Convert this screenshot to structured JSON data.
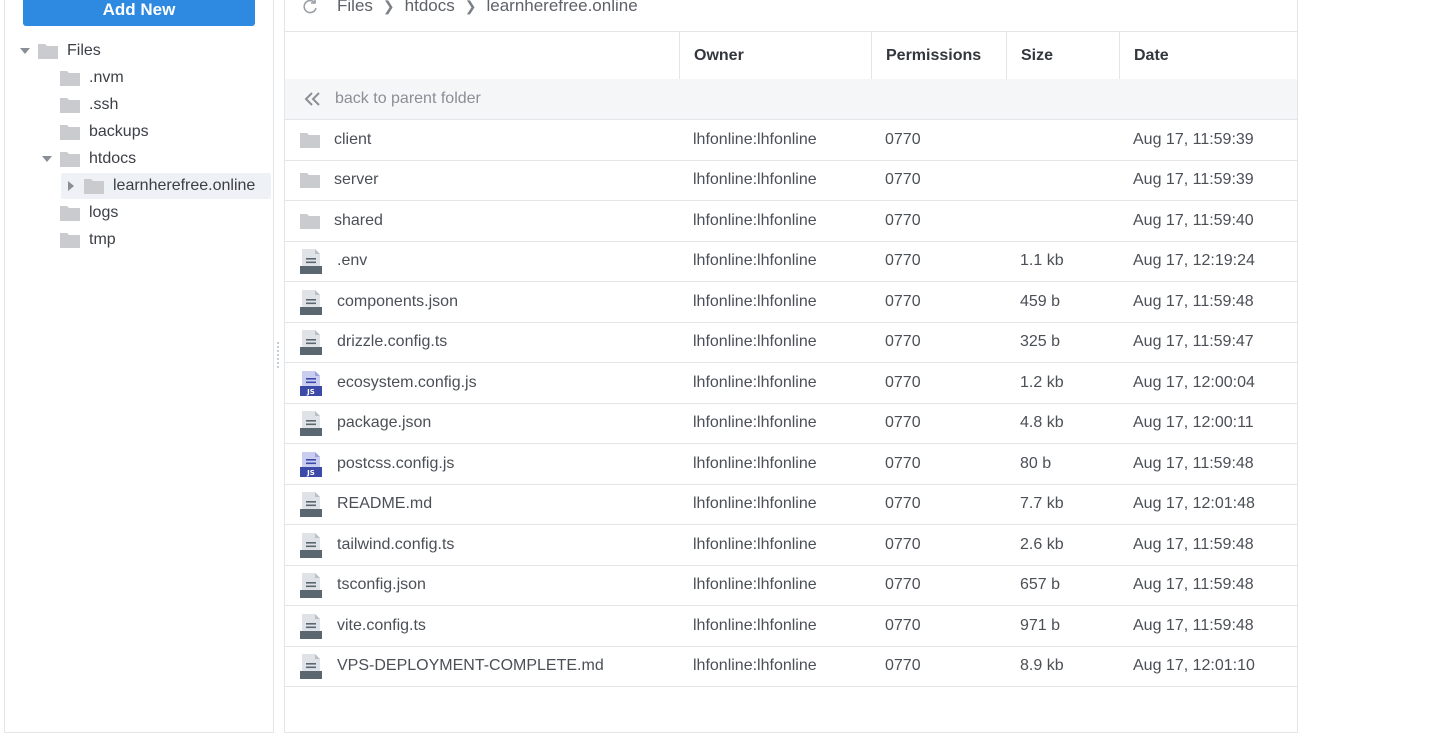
{
  "sidebar": {
    "add_new_label": "Add New",
    "tree": [
      {
        "label": "Files",
        "expanded": true
      },
      {
        "label": ".nvm"
      },
      {
        "label": ".ssh"
      },
      {
        "label": "backups"
      },
      {
        "label": "htdocs",
        "expanded": true
      },
      {
        "label": "learnherefree.online",
        "selected": true,
        "expanded": false
      },
      {
        "label": "logs"
      },
      {
        "label": "tmp"
      }
    ]
  },
  "breadcrumb": {
    "icon": "refresh-icon",
    "items": [
      "Files",
      "htdocs",
      "learnherefree.online"
    ]
  },
  "table": {
    "headers": {
      "name": "",
      "owner": "Owner",
      "permissions": "Permissions",
      "size": "Size",
      "date": "Date"
    },
    "parent_label": "back to parent folder",
    "rows": [
      {
        "type": "folder",
        "name": "client",
        "owner": "lhfonline:lhfonline",
        "permissions": "0770",
        "size": "",
        "date": "Aug 17, 11:59:39"
      },
      {
        "type": "folder",
        "name": "server",
        "owner": "lhfonline:lhfonline",
        "permissions": "0770",
        "size": "",
        "date": "Aug 17, 11:59:39"
      },
      {
        "type": "folder",
        "name": "shared",
        "owner": "lhfonline:lhfonline",
        "permissions": "0770",
        "size": "",
        "date": "Aug 17, 11:59:40"
      },
      {
        "type": "file",
        "name": ".env",
        "owner": "lhfonline:lhfonline",
        "permissions": "0770",
        "size": "1.1 kb",
        "date": "Aug 17, 12:19:24"
      },
      {
        "type": "file",
        "name": "components.json",
        "owner": "lhfonline:lhfonline",
        "permissions": "0770",
        "size": "459 b",
        "date": "Aug 17, 11:59:48"
      },
      {
        "type": "file",
        "name": "drizzle.config.ts",
        "owner": "lhfonline:lhfonline",
        "permissions": "0770",
        "size": "325 b",
        "date": "Aug 17, 11:59:47"
      },
      {
        "type": "js",
        "name": "ecosystem.config.js",
        "owner": "lhfonline:lhfonline",
        "permissions": "0770",
        "size": "1.2 kb",
        "date": "Aug 17, 12:00:04"
      },
      {
        "type": "file",
        "name": "package.json",
        "owner": "lhfonline:lhfonline",
        "permissions": "0770",
        "size": "4.8 kb",
        "date": "Aug 17, 12:00:11"
      },
      {
        "type": "js",
        "name": "postcss.config.js",
        "owner": "lhfonline:lhfonline",
        "permissions": "0770",
        "size": "80 b",
        "date": "Aug 17, 11:59:48"
      },
      {
        "type": "file",
        "name": "README.md",
        "owner": "lhfonline:lhfonline",
        "permissions": "0770",
        "size": "7.7 kb",
        "date": "Aug 17, 12:01:48"
      },
      {
        "type": "file",
        "name": "tailwind.config.ts",
        "owner": "lhfonline:lhfonline",
        "permissions": "0770",
        "size": "2.6 kb",
        "date": "Aug 17, 11:59:48"
      },
      {
        "type": "file",
        "name": "tsconfig.json",
        "owner": "lhfonline:lhfonline",
        "permissions": "0770",
        "size": "657 b",
        "date": "Aug 17, 11:59:48"
      },
      {
        "type": "file",
        "name": "vite.config.ts",
        "owner": "lhfonline:lhfonline",
        "permissions": "0770",
        "size": "971 b",
        "date": "Aug 17, 11:59:48"
      },
      {
        "type": "file",
        "name": "VPS-DEPLOYMENT-COMPLETE.md",
        "owner": "lhfonline:lhfonline",
        "permissions": "0770",
        "size": "8.9 kb",
        "date": "Aug 17, 12:01:10"
      }
    ]
  },
  "colors": {
    "accent": "#2d8ae0",
    "folder": "#c9cbcf",
    "file_icon": "#5b6770",
    "js_icon": "#3b4aa8"
  }
}
